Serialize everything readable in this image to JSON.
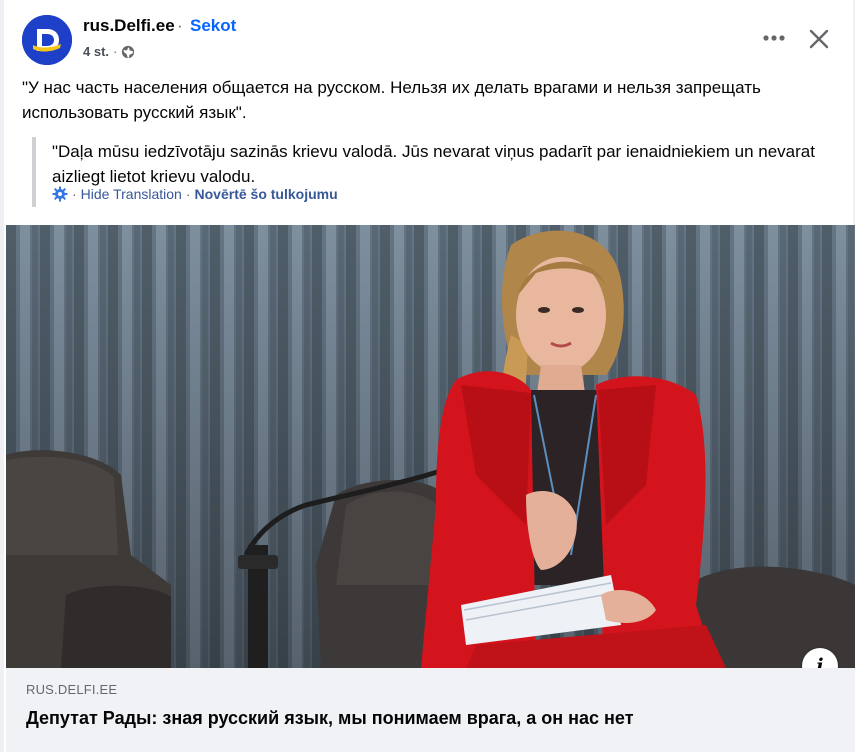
{
  "post": {
    "page_name": "rus.Delfi.ee",
    "separator": "·",
    "follow_label": "Sekot",
    "time": "4 st.",
    "time_separator": "·",
    "audience_icon": "globe-icon",
    "text": "\"У нас часть населения общается на русском. Нельзя их делать врагами и нельзя запрещать использовать русский язык\".",
    "translation": {
      "text": "\"Daļa mūsu iedzīvotāju sazinās krievu valodā. Jūs nevarat viņus padarīt par ienaidniekiem un nevarat aizliegt lietot krievu valodu.",
      "hide_label": "Hide Translation",
      "link_separator": "·",
      "rate_label": "Novērtē šo tulkojumu",
      "icon": "gear-icon"
    }
  },
  "header_actions": {
    "more_icon": "more-options-icon",
    "close_icon": "close-icon"
  },
  "link_preview": {
    "domain": "RUS.DELFI.EE",
    "headline": "Депутат Рады: зная русский язык, мы понимаем врага, а он нас нет",
    "info_icon": "info-icon",
    "info_glyph": "i"
  },
  "colors": {
    "accent": "#0866ff",
    "avatar_bg": "#1e40c8",
    "avatar_yellow": "#f5c518",
    "jacket_red": "#d4141c",
    "curtain": "#6d7e8e"
  }
}
